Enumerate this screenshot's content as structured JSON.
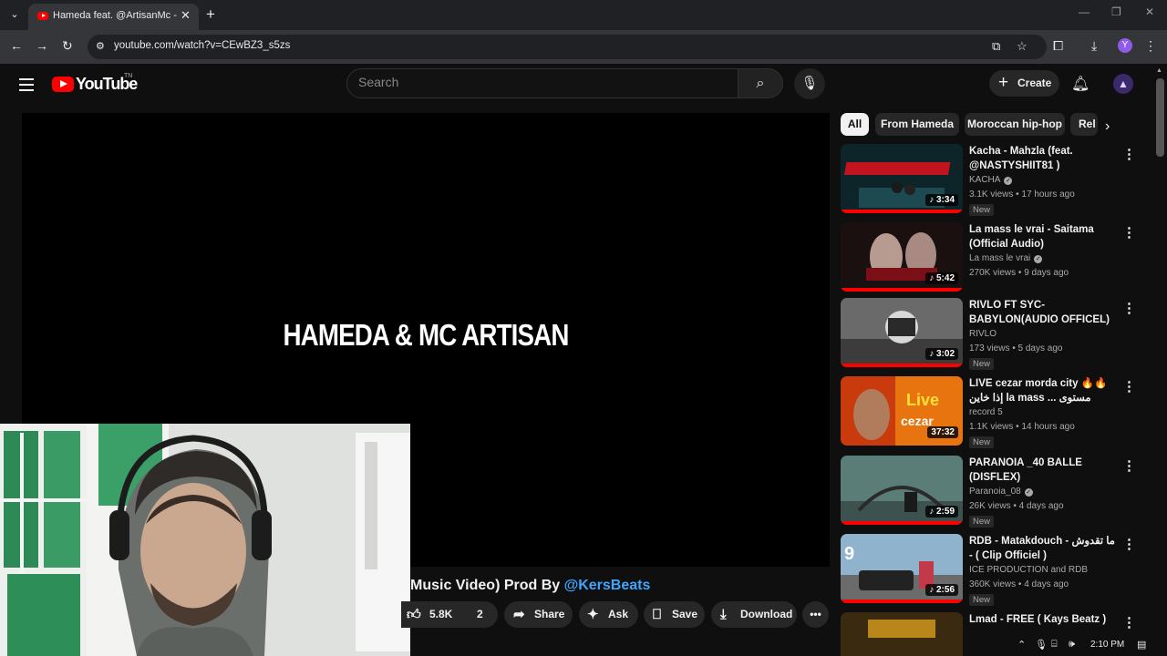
{
  "browser": {
    "tab_title": "Hameda feat. @ArtisanMc - We",
    "url": "youtube.com/watch?v=CEwBZ3_s5zs",
    "profile_initial": "Y"
  },
  "youtube": {
    "logo_text": "YouTube",
    "country_code": "TN",
    "search_placeholder": "Search",
    "create_label": "Create"
  },
  "video": {
    "frame_text": "HAMEDA & MC ARTISAN",
    "title_visible": "Music Video) Prod By ",
    "title_link": "@KersBeats",
    "likes": "5.8K",
    "comments_count": "2",
    "share_label": "Share",
    "ask_label": "Ask",
    "save_label": "Save",
    "download_label": "Download"
  },
  "chips": [
    "All",
    "From Hameda",
    "Moroccan hip-hop",
    "Rel"
  ],
  "recommendations": [
    {
      "title": "Kacha - Mahzla (feat. @NASTYSHIIT81  )",
      "channel": "KACHA",
      "verified": true,
      "meta": "3.1K views • 17 hours ago",
      "badge": "New",
      "duration": "3:34"
    },
    {
      "title": "La mass le vrai - Saitama (Official Audio)",
      "channel": "La mass le vrai",
      "verified": true,
      "meta": "270K views • 9 days ago",
      "badge": "",
      "duration": "5:42"
    },
    {
      "title": "RIVLO FT SYC-BABYLON(AUDIO OFFICEL)",
      "channel": "RIVLO",
      "verified": false,
      "meta": "173 views • 5 days ago",
      "badge": "New",
      "duration": "3:02"
    },
    {
      "title": "LIVE cezar morda city 🔥🔥 إذا خاين la mass مستوى ... فقييف اخرجو",
      "channel": "record 5",
      "verified": false,
      "meta": "1.1K views • 14 hours ago",
      "badge": "New",
      "duration": "37:32"
    },
    {
      "title": "PARANOIA _40 BALLE (DISFLEX)",
      "channel": "Paranoia_08",
      "verified": true,
      "meta": "26K views • 4 days ago",
      "badge": "New",
      "duration": "2:59"
    },
    {
      "title": "RDB - Matakdouch - ما تقدوش - ( Clip Officiel )",
      "channel": "ICE PRODUCTION and RDB",
      "verified": false,
      "meta": "360K views • 4 days ago",
      "badge": "New",
      "duration": "2:56"
    },
    {
      "title": "Lmad - FREE  ( Kays Beatz )",
      "channel": "",
      "verified": false,
      "meta": "",
      "badge": "",
      "duration": ""
    }
  ],
  "taskbar": {
    "time": "2:10 PM"
  }
}
